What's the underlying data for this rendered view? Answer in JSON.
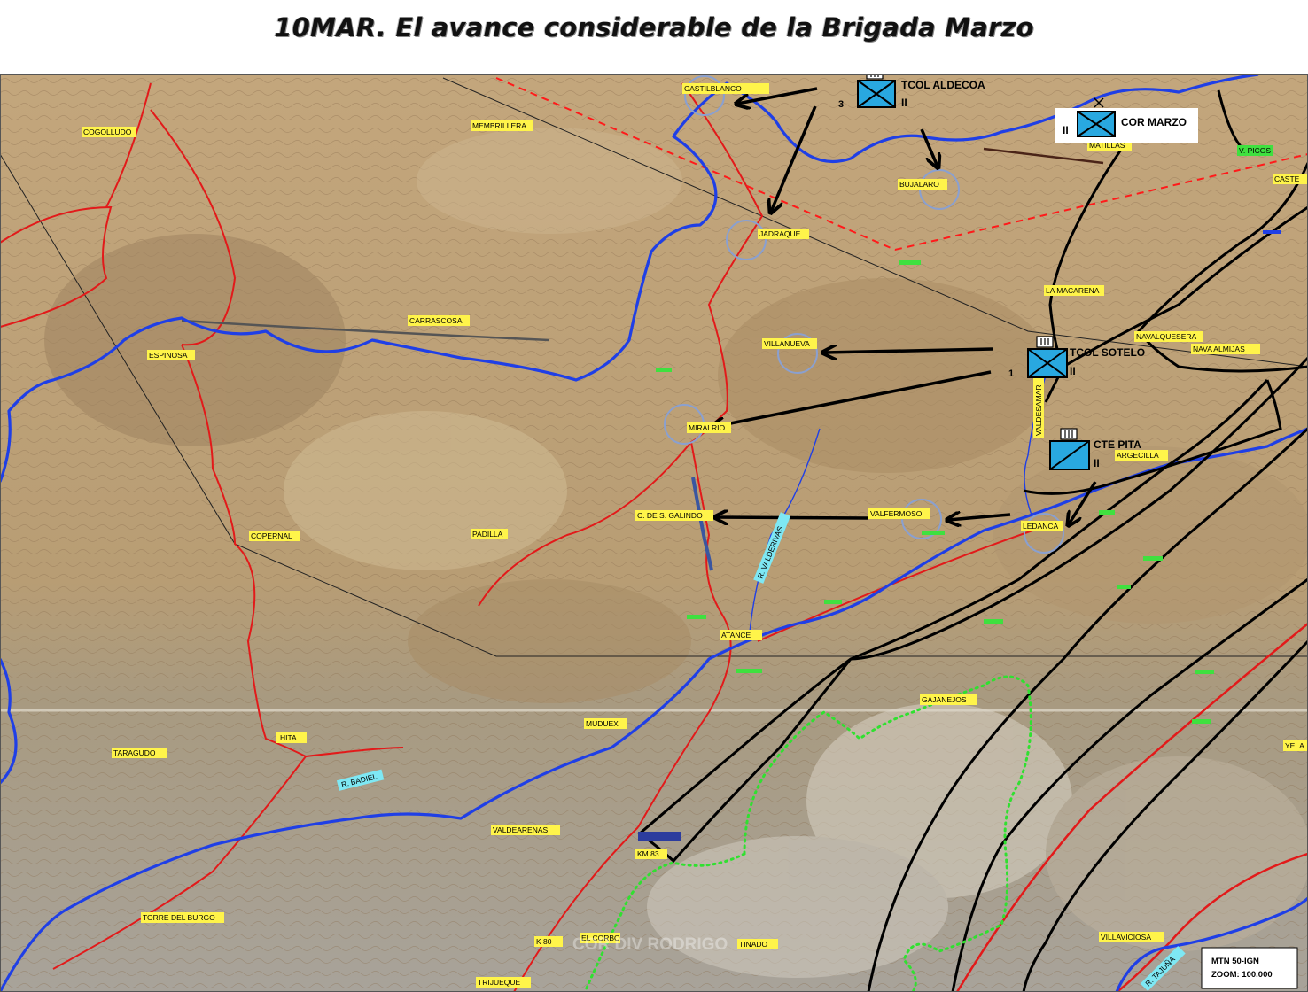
{
  "title": "10MAR. El avance considerable de la Brigada Marzo",
  "units": {
    "aldecoa": {
      "name": "TCOL ALDECOA",
      "size": "II",
      "number": "3"
    },
    "marzo": {
      "name": "COR MARZO",
      "size": "II"
    },
    "sotelo": {
      "name": "TCOL SOTELO",
      "size": "II",
      "number": "1"
    },
    "pita": {
      "name": "CTE PITA",
      "size": "II"
    }
  },
  "places": [
    "CASTILBLANCO",
    "MEMBRILLERA",
    "COGOLLUDO",
    "JADRAQUE",
    "BUJALARO",
    "MATILLAS",
    "CASTE",
    "V. PICOS",
    "CARRASCOSA",
    "ESPINOSA",
    "VILLANUEVA",
    "LA MACARENA",
    "NAVALQUESERA",
    "NAVA ALMIJAS",
    "MIRALRIO",
    "VALDESAMAR",
    "ARGECILLA",
    "COPERNAL",
    "PADILLA",
    "C. DE S. GALINDO",
    "VALFERMOSO",
    "LEDANCA",
    "ATANCE",
    "GAJANEJOS",
    "MUDUEX",
    "HITA",
    "TARAGUDO",
    "VALDEARENAS",
    "TORRE DEL BURGO",
    "TRIJUEQUE",
    "TINADO",
    "VILLAVICIOSA",
    "YELA",
    "KM 83",
    "K 80",
    "EL CORBO"
  ],
  "rivers": [
    "R. VALDERIVAS",
    "R. BADIEL",
    "R. TAJUÑA"
  ],
  "watermark": "COR DIV RODRIGO",
  "legend": {
    "line1": "MTN 50-IGN",
    "line2": "ZOOM: 100.000"
  },
  "colors": {
    "river": "#1f3fe6",
    "road": "#e21a1a",
    "front": "#000000",
    "unit_fill": "#29a8e0",
    "town_label": "#fff44a",
    "river_label": "#7ee8f4",
    "objective_circle": "#8aa0d0",
    "italian_zone": "#30e030"
  }
}
